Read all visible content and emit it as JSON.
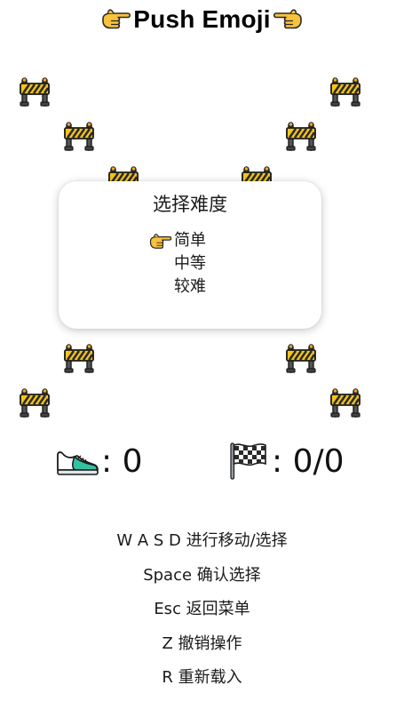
{
  "title": {
    "text": "Push Emoji",
    "left_icon": "pointing-hand-icon",
    "right_icon": "pointing-hand-icon"
  },
  "board": {
    "tile_icon": "construction-barrier-icon",
    "tile_count": 12
  },
  "difficulty_menu": {
    "title": "选择难度",
    "options": [
      {
        "label": "简单",
        "selected": true
      },
      {
        "label": "中等",
        "selected": false
      },
      {
        "label": "较难",
        "selected": false
      }
    ],
    "selector_icon": "pointing-hand-icon"
  },
  "stats": {
    "steps": {
      "icon": "sneaker-icon",
      "value": ": 0"
    },
    "goals": {
      "icon": "checkered-flag-icon",
      "value": ": 0/0"
    }
  },
  "instructions": [
    "W A S D 进行移动/选择",
    "Space 确认选择",
    "Esc 返回菜单",
    "Z 撤销操作",
    "R 重新载入"
  ],
  "colors": {
    "barrier_yellow": "#f5c518",
    "barrier_black": "#2a2a2a",
    "hand_fill": "#f7c23c",
    "shoe_accent": "#33c1a3"
  }
}
